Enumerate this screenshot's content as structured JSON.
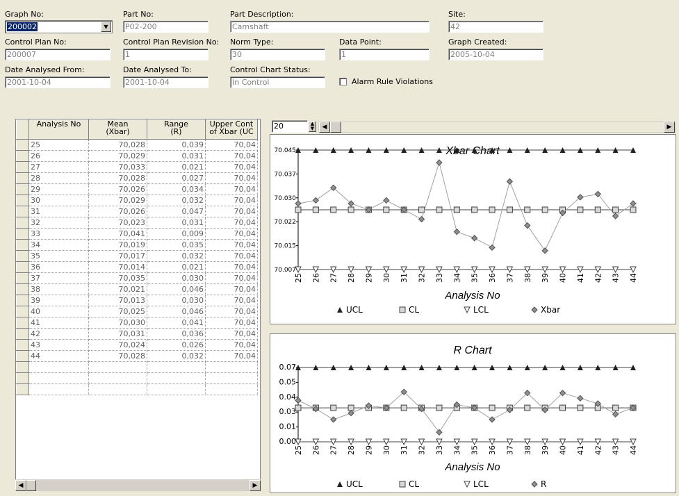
{
  "header": {
    "graph_no_label": "Graph No:",
    "graph_no_value": "200002",
    "part_no_label": "Part No:",
    "part_no_value": "P02-200",
    "part_desc_label": "Part Description:",
    "part_desc_value": "Camshaft",
    "site_label": "Site:",
    "site_value": "42",
    "control_plan_label": "Control Plan No:",
    "control_plan_value": "200007",
    "cp_rev_label": "Control Plan Revision No:",
    "cp_rev_value": "1",
    "norm_type_label": "Norm Type:",
    "norm_type_value": "30",
    "data_point_label": "Data Point:",
    "data_point_value": "1",
    "graph_created_label": "Graph Created:",
    "graph_created_value": "2005-10-04",
    "date_from_label": "Date Analysed From:",
    "date_from_value": "2001-10-04",
    "date_to_label": "Date Analysed To:",
    "date_to_value": "2001-10-04",
    "status_label": "Control Chart Status:",
    "status_value": "In Control",
    "alarm_label": "Alarm Rule Violations"
  },
  "grid": {
    "columns": [
      "Analysis No",
      "Mean\n(Xbar)",
      "Range\n(R)",
      "Upper Cont\nof Xbar (UC"
    ],
    "rows": [
      [
        "25",
        "70,028",
        "0,039",
        "70,04"
      ],
      [
        "26",
        "70,029",
        "0,031",
        "70,04"
      ],
      [
        "27",
        "70,033",
        "0,021",
        "70,04"
      ],
      [
        "28",
        "70,028",
        "0,027",
        "70,04"
      ],
      [
        "29",
        "70,026",
        "0,034",
        "70,04"
      ],
      [
        "30",
        "70,029",
        "0,032",
        "70,04"
      ],
      [
        "31",
        "70,026",
        "0,047",
        "70,04"
      ],
      [
        "32",
        "70,023",
        "0,031",
        "70,04"
      ],
      [
        "33",
        "70,041",
        "0,009",
        "70,04"
      ],
      [
        "34",
        "70,019",
        "0,035",
        "70,04"
      ],
      [
        "35",
        "70,017",
        "0,032",
        "70,04"
      ],
      [
        "36",
        "70,014",
        "0,021",
        "70,04"
      ],
      [
        "37",
        "70,035",
        "0,030",
        "70,04"
      ],
      [
        "38",
        "70,021",
        "0,046",
        "70,04"
      ],
      [
        "39",
        "70,013",
        "0,030",
        "70,04"
      ],
      [
        "40",
        "70,025",
        "0,046",
        "70,04"
      ],
      [
        "41",
        "70,030",
        "0,041",
        "70,04"
      ],
      [
        "42",
        "70,031",
        "0,036",
        "70,04"
      ],
      [
        "43",
        "70,024",
        "0,026",
        "70,04"
      ],
      [
        "44",
        "70,028",
        "0,032",
        "70,04"
      ]
    ],
    "empty_rows": 3
  },
  "chart_toolbar": {
    "points_value": "20"
  },
  "chart_data": [
    {
      "type": "line",
      "title": "Xbar Chart",
      "xlabel": "Analysis No",
      "ylabel": "",
      "x": [
        25,
        26,
        27,
        28,
        29,
        30,
        31,
        32,
        33,
        34,
        35,
        36,
        37,
        38,
        39,
        40,
        41,
        42,
        43,
        44
      ],
      "y_ticks": [
        "70.007",
        "70.015",
        "70.022",
        "70.030",
        "70.037",
        "70.045"
      ],
      "ylim": [
        70.007,
        70.045
      ],
      "series": [
        {
          "name": "UCL",
          "marker": "triangle-up",
          "values": [
            70.045,
            70.045,
            70.045,
            70.045,
            70.045,
            70.045,
            70.045,
            70.045,
            70.045,
            70.045,
            70.045,
            70.045,
            70.045,
            70.045,
            70.045,
            70.045,
            70.045,
            70.045,
            70.045,
            70.045
          ]
        },
        {
          "name": "CL",
          "marker": "square",
          "values": [
            70.026,
            70.026,
            70.026,
            70.026,
            70.026,
            70.026,
            70.026,
            70.026,
            70.026,
            70.026,
            70.026,
            70.026,
            70.026,
            70.026,
            70.026,
            70.026,
            70.026,
            70.026,
            70.026,
            70.026
          ]
        },
        {
          "name": "LCL",
          "marker": "triangle-down",
          "values": [
            70.007,
            70.007,
            70.007,
            70.007,
            70.007,
            70.007,
            70.007,
            70.007,
            70.007,
            70.007,
            70.007,
            70.007,
            70.007,
            70.007,
            70.007,
            70.007,
            70.007,
            70.007,
            70.007,
            70.007
          ]
        },
        {
          "name": "Xbar",
          "marker": "diamond",
          "values": [
            70.028,
            70.029,
            70.033,
            70.028,
            70.026,
            70.029,
            70.026,
            70.023,
            70.041,
            70.019,
            70.017,
            70.014,
            70.035,
            70.021,
            70.013,
            70.025,
            70.03,
            70.031,
            70.024,
            70.028
          ]
        }
      ],
      "legend": "bottom"
    },
    {
      "type": "line",
      "title": "R Chart",
      "xlabel": "Analysis No",
      "ylabel": "",
      "x": [
        25,
        26,
        27,
        28,
        29,
        30,
        31,
        32,
        33,
        34,
        35,
        36,
        37,
        38,
        39,
        40,
        41,
        42,
        43,
        44
      ],
      "y_ticks": [
        "0.00",
        "0.01",
        "0.03",
        "0.04",
        "0.05",
        "0.07"
      ],
      "ylim": [
        0.0,
        0.07
      ],
      "series": [
        {
          "name": "UCL",
          "marker": "triangle-up",
          "values": [
            0.07,
            0.07,
            0.07,
            0.07,
            0.07,
            0.07,
            0.07,
            0.07,
            0.07,
            0.07,
            0.07,
            0.07,
            0.07,
            0.07,
            0.07,
            0.07,
            0.07,
            0.07,
            0.07,
            0.07
          ]
        },
        {
          "name": "CL",
          "marker": "square",
          "values": [
            0.032,
            0.032,
            0.032,
            0.032,
            0.032,
            0.032,
            0.032,
            0.032,
            0.032,
            0.032,
            0.032,
            0.032,
            0.032,
            0.032,
            0.032,
            0.032,
            0.032,
            0.032,
            0.032,
            0.032
          ]
        },
        {
          "name": "LCL",
          "marker": "triangle-down",
          "values": [
            0,
            0,
            0,
            0,
            0,
            0,
            0,
            0,
            0,
            0,
            0,
            0,
            0,
            0,
            0,
            0,
            0,
            0,
            0,
            0
          ]
        },
        {
          "name": "R",
          "marker": "diamond",
          "values": [
            0.039,
            0.031,
            0.021,
            0.027,
            0.034,
            0.032,
            0.047,
            0.031,
            0.009,
            0.035,
            0.032,
            0.021,
            0.03,
            0.046,
            0.03,
            0.046,
            0.041,
            0.036,
            0.026,
            0.032
          ]
        }
      ],
      "legend": "bottom"
    }
  ]
}
